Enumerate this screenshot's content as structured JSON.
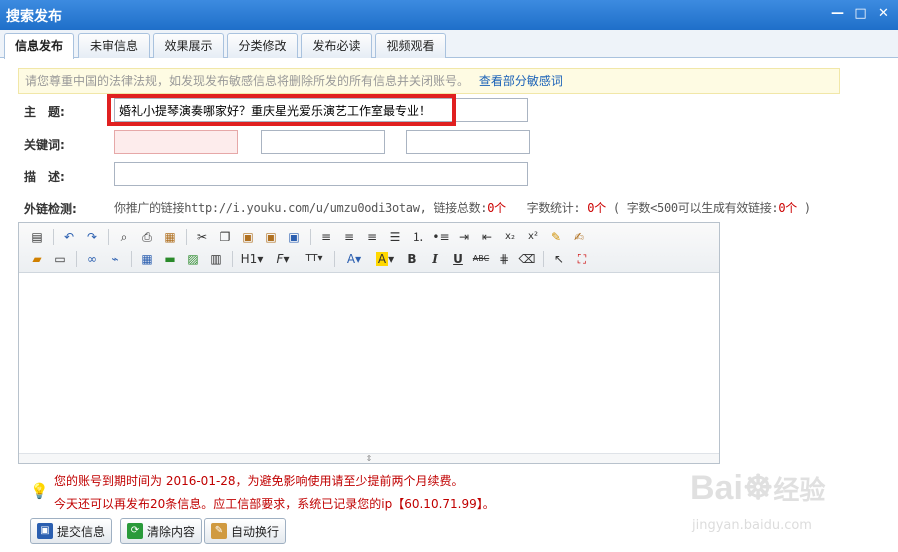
{
  "window": {
    "title": "搜索发布",
    "controls": [
      "minimize-icon",
      "maximize-icon",
      "close-icon"
    ]
  },
  "tabs": [
    {
      "label": "信息发布",
      "active": true
    },
    {
      "label": "未审信息",
      "active": false
    },
    {
      "label": "效果展示",
      "active": false
    },
    {
      "label": "分类修改",
      "active": false
    },
    {
      "label": "发布必读",
      "active": false
    },
    {
      "label": "视频观看",
      "active": false
    }
  ],
  "notice": {
    "text": "请您尊重中国的法律法规，如发现发布敏感信息将删除所发的所有信息并关闭账号。",
    "link": "查看部分敏感词"
  },
  "form": {
    "subject_label": "主　题:",
    "subject_value": "婚礼小提琴演奏哪家好？重庆星光爱乐演艺工作室最专业！",
    "keywords_label": "关键词:",
    "keyword1": "",
    "keyword2": "",
    "keyword3": "",
    "description_label": "描　述:",
    "description_value": ""
  },
  "link_check": {
    "label": "外链检测:",
    "prefix": "你推广的链接http://i.youku.com/u/umzu0odi3otaw, 链接总数:",
    "link_count": "0个",
    "word_stats_label": "字数统计:",
    "word_count": "0个",
    "rule_prefix": "( 字数<500可以生成有效链接:",
    "valid_links": "0个",
    "rule_suffix": ")"
  },
  "editor": {
    "toolbar_row1": [
      "source-icon",
      "undo-icon",
      "redo-icon",
      "preview-icon",
      "print-icon",
      "template-icon",
      "cut-icon",
      "copy-icon",
      "paste-icon",
      "paste-text-icon",
      "paste-word-icon",
      "align-left-icon",
      "align-center-icon",
      "align-right-icon",
      "justify-icon",
      "ordered-list-icon",
      "unordered-list-icon",
      "indent-icon",
      "outdent-icon",
      "subscript-icon",
      "superscript-icon",
      "clear-format-icon",
      "select-all-icon"
    ],
    "toolbar_row2_labels": {
      "heading": "H1",
      "font": "F",
      "size": "TT",
      "font_color": "A",
      "bg_color": "A",
      "bold": "B",
      "italic": "I",
      "underline": "U",
      "strike": "ABC"
    },
    "content": ""
  },
  "tips": {
    "expire": "您的账号到期时间为 2016-01-28，为避免影响使用请至少提前两个月续费。",
    "quota": "今天还可以再发布20条信息。应工信部要求，系统已记录您的ip【60.10.71.99】。"
  },
  "buttons": {
    "submit": "提交信息",
    "clear": "清除内容",
    "autowrap": "自动换行"
  },
  "watermark": {
    "brand": "Bai",
    "brand2": "经验",
    "url": "jingyan.baidu.com"
  },
  "colors": {
    "titlebar": "#2a7bd6",
    "highlight": "#e02020",
    "alert_text": "#c00000",
    "link": "#1b62b8"
  }
}
